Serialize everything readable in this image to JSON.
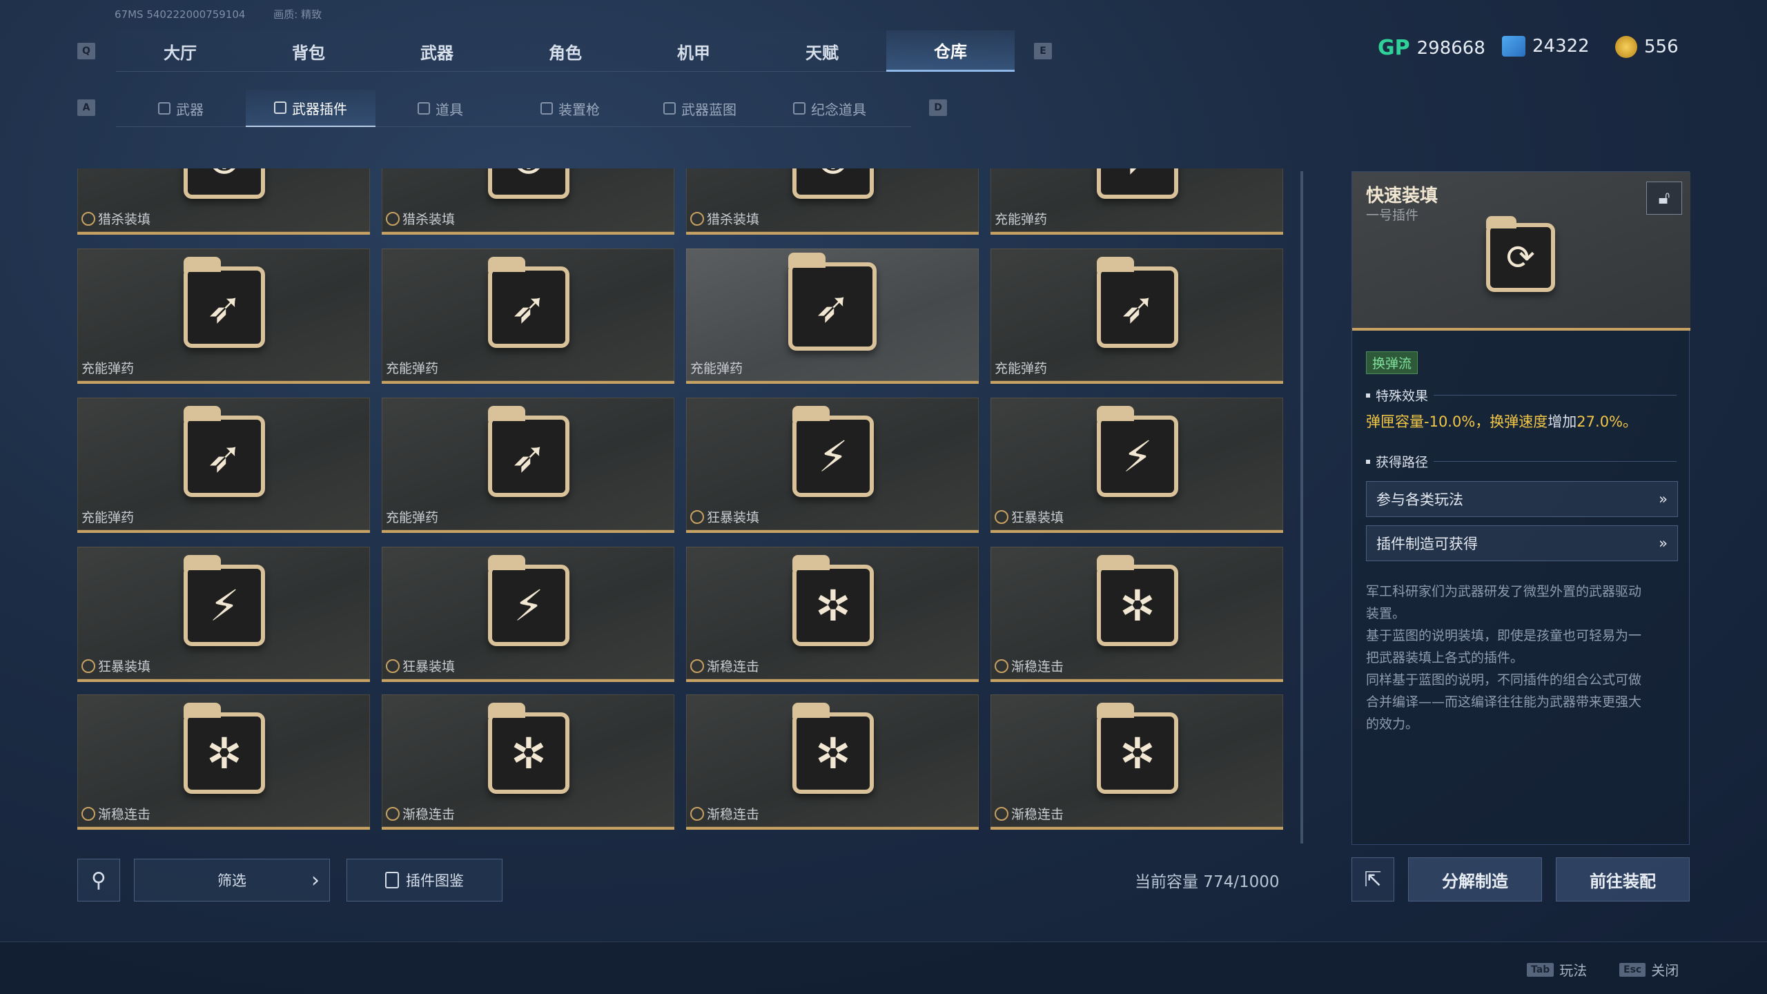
{
  "top_info": {
    "version": "67MS 540222000759104",
    "quality": "画质: 精致"
  },
  "keys": {
    "q": "Q",
    "e": "E",
    "a": "A",
    "d": "D"
  },
  "tabs": [
    "大厅",
    "背包",
    "武器",
    "角色",
    "机甲",
    "天赋",
    "仓库"
  ],
  "active_tab": "仓库",
  "subtabs": [
    "武器",
    "武器插件",
    "道具",
    "装置枪",
    "武器蓝图",
    "纪念道具"
  ],
  "active_subtab": "武器插件",
  "currency": [
    {
      "icon": "gp-icon",
      "label": "GP",
      "value": "298668"
    },
    {
      "icon": "ticket-icon",
      "value": "24322"
    },
    {
      "icon": "coin-icon",
      "value": "556"
    }
  ],
  "cards": [
    {
      "name": "猎杀装填",
      "icon": "crosshair-icon",
      "badge": true
    },
    {
      "name": "猎杀装填",
      "icon": "crosshair-icon",
      "badge": true
    },
    {
      "name": "猎杀装填",
      "icon": "crosshair-icon",
      "badge": true
    },
    {
      "name": "充能弹药",
      "icon": "bullets-icon",
      "badge": false
    },
    {
      "name": "充能弹药",
      "icon": "bullets-icon",
      "badge": false
    },
    {
      "name": "充能弹药",
      "icon": "bullets-icon",
      "badge": false
    },
    {
      "name": "充能弹药",
      "icon": "bullets-icon",
      "badge": false
    },
    {
      "name": "充能弹药",
      "icon": "bullets-icon",
      "badge": false
    },
    {
      "name": "充能弹药",
      "icon": "bullets-icon",
      "badge": false
    },
    {
      "name": "充能弹药",
      "icon": "bullets-icon",
      "badge": false
    },
    {
      "name": "狂暴装填",
      "icon": "gun-icon",
      "badge": true
    },
    {
      "name": "狂暴装填",
      "icon": "gun-icon",
      "badge": true
    },
    {
      "name": "狂暴装填",
      "icon": "gun-icon",
      "badge": true
    },
    {
      "name": "狂暴装填",
      "icon": "gun-icon",
      "badge": true
    },
    {
      "name": "渐稳连击",
      "icon": "shield-icon",
      "badge": true
    },
    {
      "name": "渐稳连击",
      "icon": "shield-icon",
      "badge": true
    },
    {
      "name": "渐稳连击",
      "icon": "shield-icon",
      "badge": true
    },
    {
      "name": "渐稳连击",
      "icon": "shield-icon",
      "badge": true
    },
    {
      "name": "渐稳连击",
      "icon": "shield-icon",
      "badge": true
    },
    {
      "name": "渐稳连击",
      "icon": "shield-icon",
      "badge": true
    }
  ],
  "detail": {
    "title": "快速装填",
    "subtitle": "一号插件",
    "icon": "reload-icon",
    "tag": "换弹流",
    "effect_header": "特殊效果",
    "effect_part1": "弹匣容量-10.0%，换弹速度",
    "effect_part2": "增加",
    "effect_part3": "27.0%。",
    "route_header": "获得路径",
    "routes": [
      "参与各类玩法",
      "插件制造可获得"
    ],
    "description_lines": [
      "军工科研家们为武器研发了微型外置的武器驱动",
      "装置。",
      "基于蓝图的说明装填，即使是孩童也可轻易为一",
      "把武器装填上各式的插件。",
      "同样基于蓝图的说明，不同插件的组合公式可做",
      "合并编译——而这编译往往能为武器带来更强大",
      "的效力。"
    ]
  },
  "bottom": {
    "filter_label": "筛选",
    "catalog_label": "插件图鉴",
    "capacity": "当前容量 774/1000",
    "decompose_label": "分解制造",
    "equip_label": "前往装配"
  },
  "footer": [
    {
      "key": "Tab",
      "label": "玩法"
    },
    {
      "key": "Esc",
      "label": "关闭"
    }
  ]
}
